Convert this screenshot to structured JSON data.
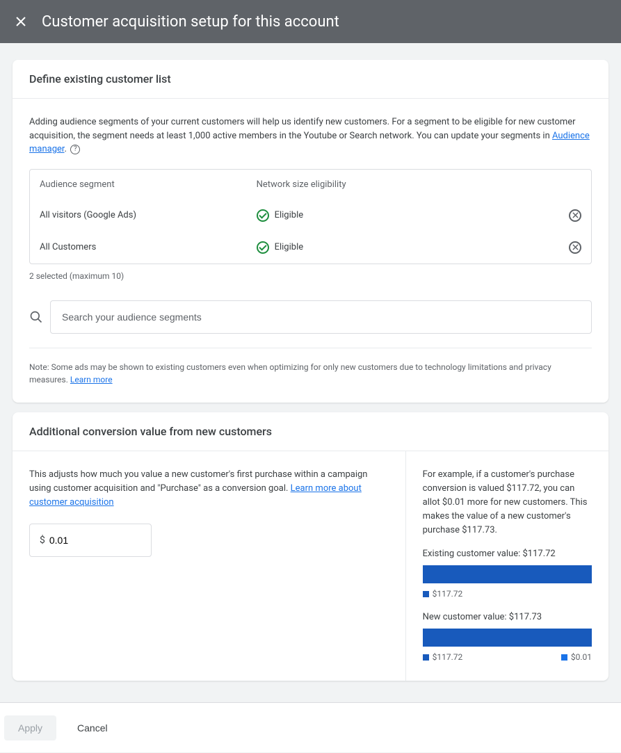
{
  "header": {
    "title": "Customer acquisition setup for this account"
  },
  "card1": {
    "title": "Define existing customer list",
    "intro_pre": "Adding audience segments of your current customers will help us identify new customers. For a segment to be eligible for new customer acquisition, the segment needs at least 1,000 active members in the Youtube or Search network. You can update your segments in ",
    "intro_link": "Audience manager",
    "intro_post": ".",
    "col1_header": "Audience segment",
    "col2_header": "Network size eligibility",
    "rows": [
      {
        "name": "All visitors (Google Ads)",
        "status": "Eligible"
      },
      {
        "name": "All Customers",
        "status": "Eligible"
      }
    ],
    "selected_text": "2 selected (maximum 10)",
    "search_placeholder": "Search your audience segments",
    "note_pre": "Note: Some ads may be shown to existing customers even when optimizing for only new customers due to technology limitations and privacy measures. ",
    "note_link": "Learn more"
  },
  "card2": {
    "title": "Additional conversion value from new customers",
    "desc_pre": "This adjusts how much you value a new customer's first purchase within a campaign using customer acquisition and \"Purchase\" as a conversion goal. ",
    "desc_link": "Learn more about customer acquisition",
    "currency": "$",
    "value": "0.01",
    "example": "For example, if a customer's purchase conversion is valued $117.72, you can allot $0.01 more for new customers. This makes the value of a new customer's purchase $117.73.",
    "existing_label": "Existing customer value: $117.72",
    "existing_legend": "$117.72",
    "new_label": "New customer value: $117.73",
    "new_legend_a": "$117.72",
    "new_legend_b": "$0.01"
  },
  "footer": {
    "apply": "Apply",
    "cancel": "Cancel"
  }
}
